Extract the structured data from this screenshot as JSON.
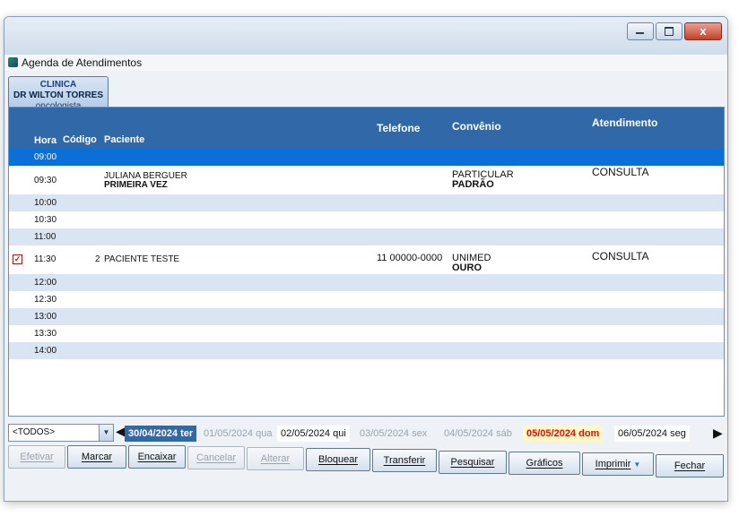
{
  "window": {
    "minimize_glyph": "minimize-icon",
    "maximize_glyph": "maximize-icon",
    "close_label": "x"
  },
  "form": {
    "title": "Agenda de Atendimentos"
  },
  "doctor": {
    "clinic": "CLINICA",
    "name": "DR WILTON TORRES",
    "specialty": "oncologista"
  },
  "grid": {
    "columns": {
      "hora": "Hora",
      "codigo": "Código",
      "paciente": "Paciente",
      "telefone": "Telefone",
      "convenio": "Convênio",
      "atendimento": "Atendimento"
    },
    "rows": [
      {
        "hora": "09:00",
        "codigo": "",
        "paciente": "",
        "paciente2": "",
        "telefone": "",
        "convenio": "",
        "convenio2": "",
        "atendimento": "",
        "checked": false
      },
      {
        "hora": "09:30",
        "codigo": "",
        "paciente": "JULIANA BERGUER",
        "paciente2": "PRIMEIRA VEZ",
        "telefone": "",
        "convenio": "PARTICULAR",
        "convenio2": "PADRÃO",
        "atendimento": "CONSULTA",
        "checked": false
      },
      {
        "hora": "10:00",
        "codigo": "",
        "paciente": "",
        "paciente2": "",
        "telefone": "",
        "convenio": "",
        "convenio2": "",
        "atendimento": "",
        "checked": false
      },
      {
        "hora": "10:30",
        "codigo": "",
        "paciente": "",
        "paciente2": "",
        "telefone": "",
        "convenio": "",
        "convenio2": "",
        "atendimento": "",
        "checked": false
      },
      {
        "hora": "11:00",
        "codigo": "",
        "paciente": "",
        "paciente2": "",
        "telefone": "",
        "convenio": "",
        "convenio2": "",
        "atendimento": "",
        "checked": false
      },
      {
        "hora": "11:30",
        "codigo": "2",
        "paciente": "PACIENTE TESTE",
        "paciente2": "",
        "telefone": "11 00000-0000",
        "convenio": "UNIMED",
        "convenio2": "OURO",
        "atendimento": "CONSULTA",
        "checked": true
      },
      {
        "hora": "12:00",
        "codigo": "",
        "paciente": "",
        "paciente2": "",
        "telefone": "",
        "convenio": "",
        "convenio2": "",
        "atendimento": "",
        "checked": false
      },
      {
        "hora": "12:30",
        "codigo": "",
        "paciente": "",
        "paciente2": "",
        "telefone": "",
        "convenio": "",
        "convenio2": "",
        "atendimento": "",
        "checked": false
      },
      {
        "hora": "13:00",
        "codigo": "",
        "paciente": "",
        "paciente2": "",
        "telefone": "",
        "convenio": "",
        "convenio2": "",
        "atendimento": "",
        "checked": false
      },
      {
        "hora": "13:30",
        "codigo": "",
        "paciente": "",
        "paciente2": "",
        "telefone": "",
        "convenio": "",
        "convenio2": "",
        "atendimento": "",
        "checked": false
      },
      {
        "hora": "14:00",
        "codigo": "",
        "paciente": "",
        "paciente2": "",
        "telefone": "",
        "convenio": "",
        "convenio2": "",
        "atendimento": "",
        "checked": false
      }
    ]
  },
  "filter": {
    "value": "<TODOS>",
    "arrow_icon": "chevron-down-icon"
  },
  "dates": {
    "prev_icon": "chevron-left-icon",
    "next_icon": "chevron-right-icon",
    "tabs": [
      {
        "label": "30/04/2024 ter",
        "state": "active"
      },
      {
        "label": "01/05/2024 qua",
        "state": "dim"
      },
      {
        "label": "02/05/2024 qui",
        "state": "bright"
      },
      {
        "label": "03/05/2024 sex",
        "state": "dim"
      },
      {
        "label": "04/05/2024 sáb",
        "state": "dim"
      },
      {
        "label": "05/05/2024 dom",
        "state": "today"
      },
      {
        "label": "06/05/2024 seg",
        "state": "bright"
      }
    ]
  },
  "buttons": {
    "efetivar": "Efetivar",
    "marcar": "Marcar",
    "encaixar": "Encaixar",
    "cancelar": "Cancelar",
    "alterar": "Alterar",
    "bloquear": "Bloquear",
    "transferir": "Transferir",
    "pesquisar": "Pesquisar",
    "graficos": "Gráficos",
    "imprimir": "Imprimir",
    "fechar": "Fechar"
  },
  "colors": {
    "header_blue": "#3168a8",
    "selected_row": "#0a6fd6",
    "alt_row": "#d9e5f2",
    "today_red": "#d4140c"
  }
}
